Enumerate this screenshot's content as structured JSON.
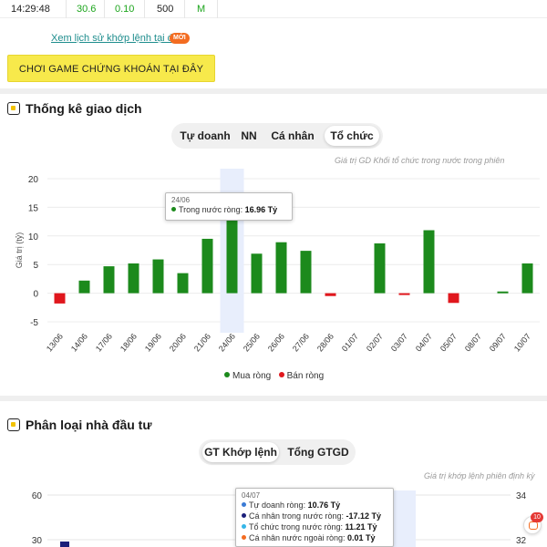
{
  "trade_row": {
    "time": "14:29:48",
    "price": "30.6",
    "change": "0.10",
    "volume": "500",
    "side": "M"
  },
  "history_link": "Xem lịch sử khớp lệnh tại đây",
  "new_badge": "MỚI",
  "game_button": "CHƠI GAME CHỨNG KHOÁN TẠI ĐÂY",
  "colors": {
    "buy": "#1c8a1c",
    "sell": "#e0171d",
    "accent_link": "#1e8d8d",
    "game_bg": "#f7e94b"
  },
  "stats_section": {
    "title": "Thống kê giao dịch",
    "icon": "stats-icon",
    "tabs": [
      "Tự doanh",
      "NN",
      "Cá nhân",
      "Tổ chức"
    ],
    "active_tab": 3,
    "note": "Giá trị GD Khối tổ chức trong nước trong phiên",
    "legend_buy": "Mua ròng",
    "legend_sell": "Bán ròng",
    "tooltip": {
      "date": "24/06",
      "label": "Trong nước ròng:",
      "value": "16.96 Tỷ"
    }
  },
  "chart_data": {
    "type": "bar",
    "categories": [
      "13/06",
      "14/06",
      "17/06",
      "18/06",
      "19/06",
      "20/06",
      "21/06",
      "24/06",
      "25/06",
      "26/06",
      "27/06",
      "28/06",
      "01/07",
      "02/07",
      "03/07",
      "04/07",
      "05/07",
      "08/07",
      "09/07",
      "10/07"
    ],
    "values": [
      -1.8,
      2.2,
      4.7,
      5.2,
      5.9,
      3.5,
      9.5,
      16.96,
      6.9,
      8.9,
      7.4,
      -0.5,
      0,
      8.7,
      -0.2,
      11.0,
      -1.7,
      0,
      0.3,
      5.2
    ],
    "ylabel": "Giá trị (tỷ)",
    "ylim": [
      -5,
      20
    ],
    "yticks": [
      20,
      15,
      10,
      5,
      0,
      -5
    ],
    "highlight_index": 7,
    "grid": true
  },
  "investor_section": {
    "title": "Phân loại nhà đầu tư",
    "icon": "investor-icon",
    "tabs": [
      "GT Khớp lệnh",
      "Tổng GTGD"
    ],
    "active_tab": 0,
    "note": "Giá trị khớp lệnh phiên định kỳ",
    "left_ticks": [
      "60",
      "30"
    ],
    "right_ticks": [
      "34",
      "32"
    ],
    "tooltip": {
      "date": "04/07",
      "rows": [
        {
          "label": "Tự doanh ròng:",
          "value": "10.76 Tỷ",
          "color": "#3a7bd5"
        },
        {
          "label": "Cá nhân trong nước ròng:",
          "value": "-17.12 Tỷ",
          "color": "#1b1f7a"
        },
        {
          "label": "Tổ chức trong nước ròng:",
          "value": "11.21 Tỷ",
          "color": "#36b6e8"
        },
        {
          "label": "Cá nhân nước ngoài ròng:",
          "value": "0.01 Tỷ",
          "color": "#f36c21"
        }
      ]
    }
  },
  "chat_badge": "10"
}
